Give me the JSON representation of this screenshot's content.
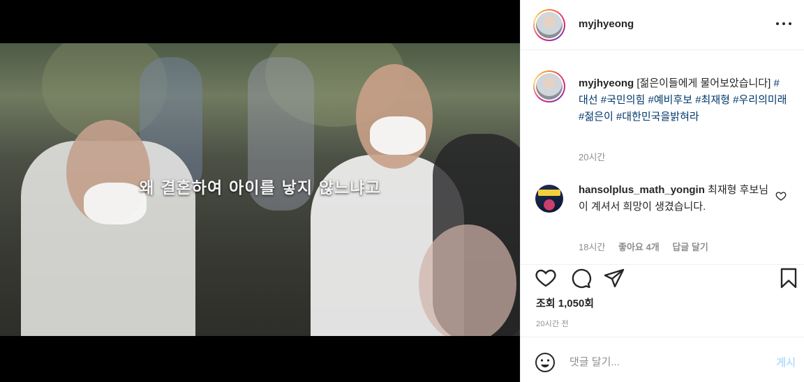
{
  "post": {
    "username": "myjhyeong",
    "video_subtitle": "왜 결혼하여 아이를 낳지 않느냐고"
  },
  "caption": {
    "username": "myjhyeong",
    "text": "[젊은이들에게 물어보았습니다]",
    "hashtags": [
      "#대선",
      "#국민의힘",
      "#예비후보",
      "#최재형",
      "#우리의미래",
      "#젊은이",
      "#대한민국을밝혀라"
    ],
    "time": "20시간"
  },
  "comments": [
    {
      "username": "hansolplus_math_yongin",
      "text": "최재형 후보님이 계셔서 희망이 생겼습니다.",
      "time": "18시간",
      "likes": "좋아요 4개",
      "reply_label": "답글 달기"
    }
  ],
  "stats": {
    "views": "조회 1,050회",
    "posted": "20시간 전"
  },
  "add_comment": {
    "placeholder": "댓글 달기...",
    "post_label": "게시"
  },
  "icons": {
    "more": "more-icon",
    "like": "heart-icon",
    "comment": "comment-bubble-icon",
    "share": "paper-plane-icon",
    "save": "bookmark-icon",
    "emoji": "emoji-icon"
  },
  "colors": {
    "hashtag": "#00376b",
    "muted": "#8e8e8e",
    "post_button_disabled": "#b2dffc"
  }
}
